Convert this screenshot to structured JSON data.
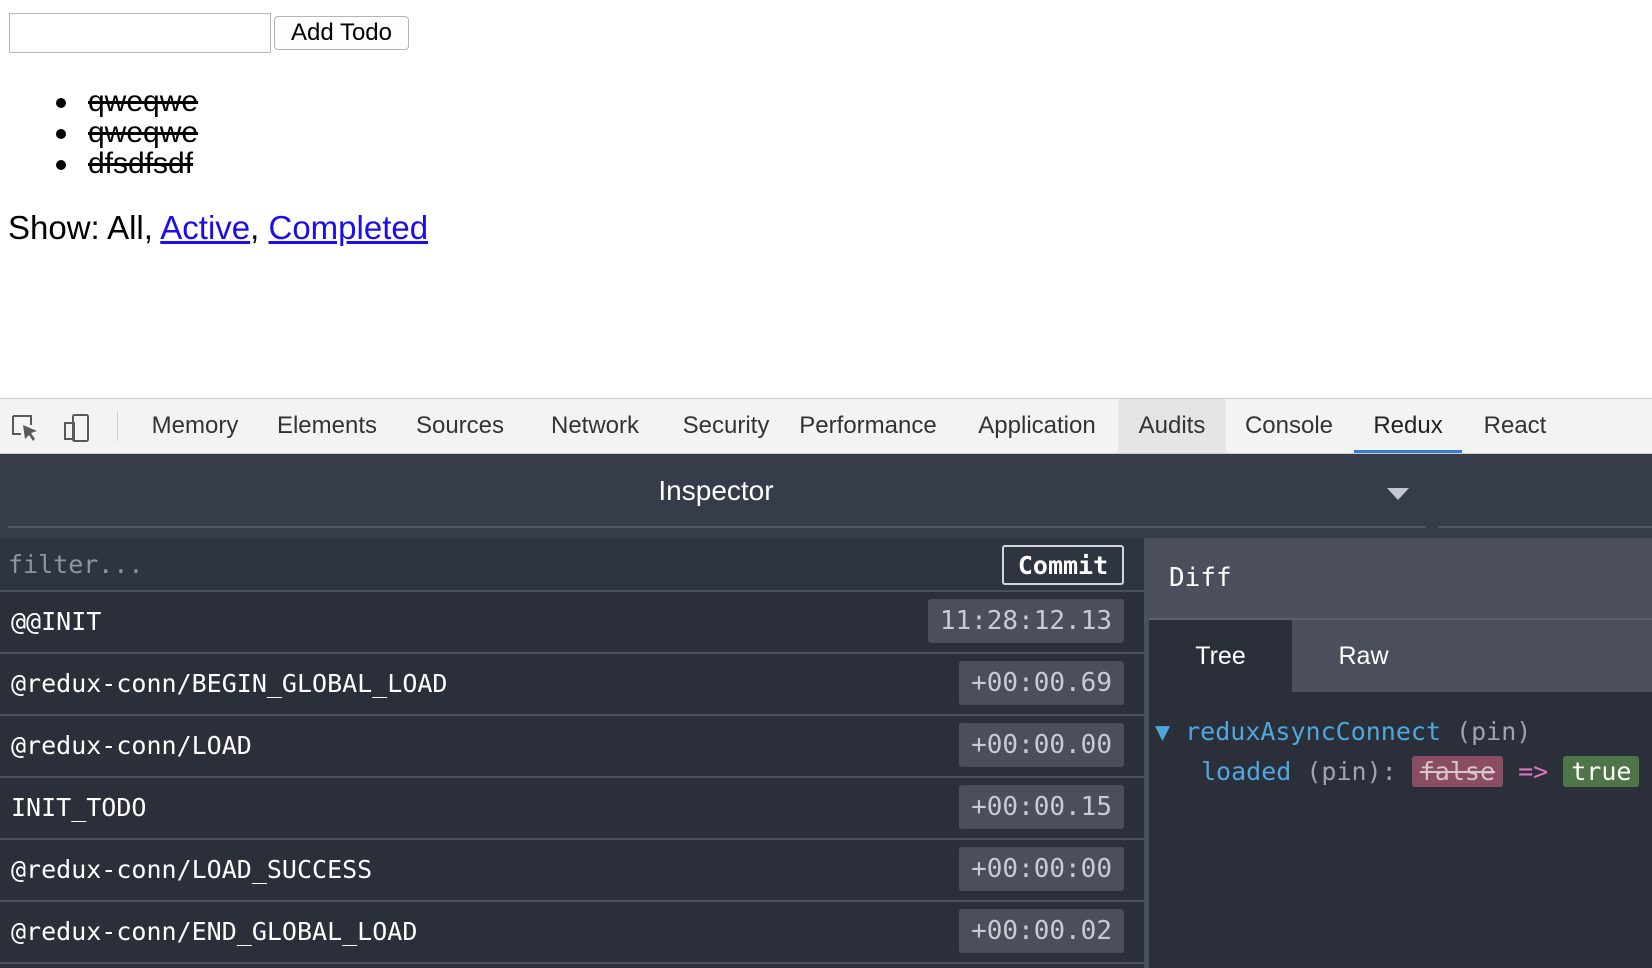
{
  "app": {
    "input": {
      "value": "",
      "placeholder": ""
    },
    "add_button": "Add Todo",
    "todos": [
      "qweqwe",
      "qweqwe",
      "dfsdfsdf"
    ],
    "filter": {
      "prefix": "Show: All,",
      "active": "Active",
      "separator": ",",
      "completed": "Completed"
    }
  },
  "devtools": {
    "tabs": [
      "Memory",
      "Elements",
      "Sources",
      "Network",
      "Security",
      "Performance",
      "Application",
      "Audits",
      "Console",
      "Redux",
      "React"
    ],
    "selected_tab": "Redux",
    "hovered_tab": "Audits",
    "icons": [
      "inspect-element-icon",
      "device-toolbar-icon"
    ]
  },
  "redux": {
    "monitor_title": "Inspector",
    "filter_placeholder": "filter...",
    "commit_label": "Commit",
    "actions": [
      {
        "name": "@@INIT",
        "time": "11:28:12.13"
      },
      {
        "name": "@redux-conn/BEGIN_GLOBAL_LOAD",
        "time": "+00:00.69"
      },
      {
        "name": "@redux-conn/LOAD",
        "time": "+00:00.00"
      },
      {
        "name": "INIT_TODO",
        "time": "+00:00.15"
      },
      {
        "name": "@redux-conn/LOAD_SUCCESS",
        "time": "+00:00:00"
      },
      {
        "name": "@redux-conn/END_GLOBAL_LOAD",
        "time": "+00:00.02"
      }
    ],
    "diff": {
      "title": "Diff",
      "view_tabs": [
        "Tree",
        "Raw"
      ],
      "active_view": "Tree",
      "root_key": "reduxAsyncConnect",
      "pin": "(pin)",
      "child_key": "loaded",
      "child_pin": "(pin):",
      "old_value": "false",
      "arrow": "=>",
      "new_value": "true"
    }
  },
  "colors": {
    "link": "#1a0dee",
    "tab_selected_underline": "#3879d9",
    "panel_bg": "#2a2f3a",
    "diff_key": "#4fa8dc",
    "diff_old_bg": "#8a4d63",
    "diff_new_bg": "#4f7448"
  }
}
